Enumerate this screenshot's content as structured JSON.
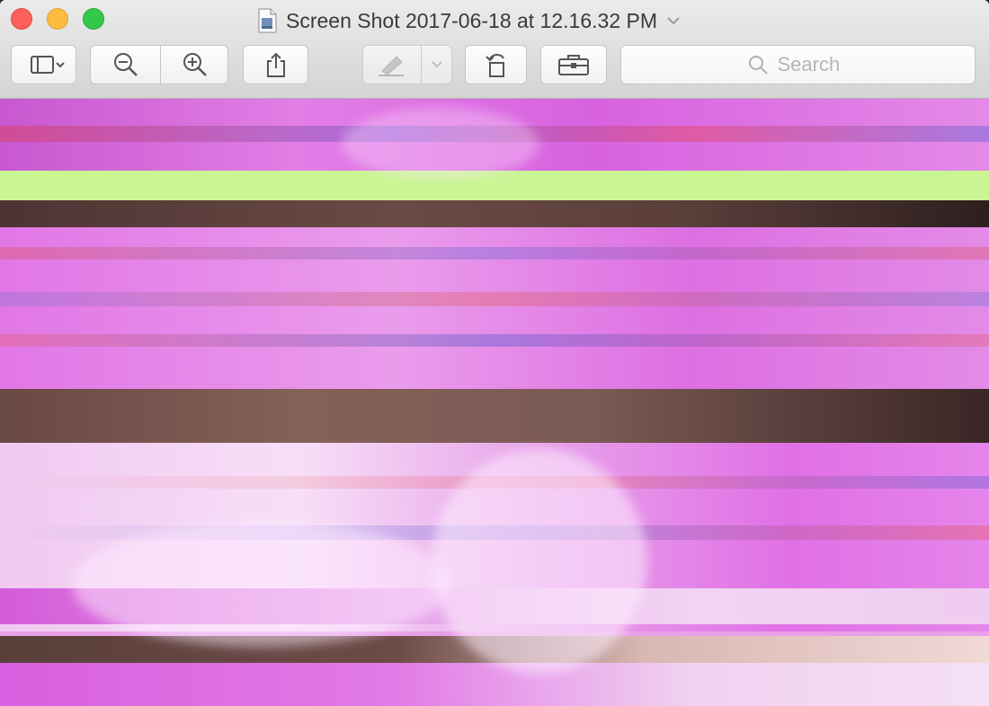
{
  "window": {
    "title": "Screen Shot 2017-06-18 at 12.16.32 PM"
  },
  "toolbar": {
    "search_placeholder": "Search"
  },
  "icons": {
    "close": "close-traffic-light",
    "minimize": "minimize-traffic-light",
    "zoom": "zoom-traffic-light",
    "document": "document-icon",
    "title_menu": "chevron-down-icon",
    "sidebar": "sidebar-icon",
    "zoom_out": "zoom-out-icon",
    "zoom_in": "zoom-in-icon",
    "share": "share-icon",
    "markup": "pen-icon",
    "rotate": "rotate-left-icon",
    "toolbox": "toolbox-icon",
    "search": "search-icon"
  },
  "colors": {
    "close": "#fc605c",
    "minimize": "#fdbc40",
    "zoom": "#34c84a",
    "image_magenta": "#e36ae6",
    "image_green": "#c8ff8a",
    "image_brown": "#6b4a45"
  }
}
